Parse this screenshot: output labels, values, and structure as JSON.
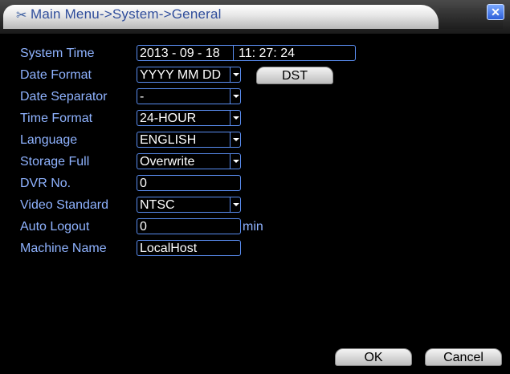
{
  "window": {
    "title": "Main Menu->System->General"
  },
  "fields": {
    "system_time": {
      "label": "System Time",
      "date": "2013 - 09 - 18",
      "time": "11: 27: 24"
    },
    "date_format": {
      "label": "Date Format",
      "value": "YYYY MM DD",
      "button": "DST"
    },
    "date_separator": {
      "label": "Date Separator",
      "value": "-"
    },
    "time_format": {
      "label": "Time Format",
      "value": "24-HOUR"
    },
    "language": {
      "label": "Language",
      "value": "ENGLISH"
    },
    "storage_full": {
      "label": "Storage Full",
      "value": "Overwrite"
    },
    "dvr_no": {
      "label": "DVR No.",
      "value": "0"
    },
    "video_standard": {
      "label": "Video Standard",
      "value": "NTSC"
    },
    "auto_logout": {
      "label": "Auto Logout",
      "value": "0",
      "unit": "min"
    },
    "machine_name": {
      "label": "Machine Name",
      "value": "LocalHost"
    }
  },
  "footer": {
    "ok_label": "OK",
    "cancel_label": "Cancel"
  }
}
